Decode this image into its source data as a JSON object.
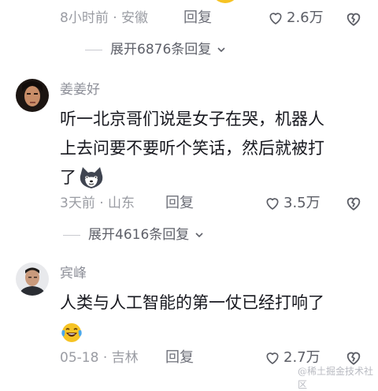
{
  "comments": [
    {
      "time": "8小时前",
      "location": "安徽",
      "reply": "回复",
      "likes": "2.6万",
      "expand": "展开6876条回复",
      "dot": "·"
    },
    {
      "username": "姜姜好",
      "text_line1": "听一北京哥们说是女子在哭，机器人",
      "text_line2": "上去问要不要听个笑话，然后就被打",
      "text_line3": "了",
      "emoji": "husky-dog-emoji",
      "time": "3天前",
      "location": "山东",
      "reply": "回复",
      "likes": "3.5万",
      "expand": "展开4616条回复",
      "dot": "·"
    },
    {
      "username": "宾峰",
      "text_line1": "人类与人工智能的第一仗已经打响了",
      "emoji": "laughing-tears-emoji",
      "time": "05-18",
      "location": "吉林",
      "reply": "回复",
      "likes": "2.7万",
      "dot": "·"
    }
  ],
  "watermark": "@稀土掘金技术社区",
  "colors": {
    "background": "#ffffff",
    "meta_gray": "#9a9ca3",
    "text": "#17181f",
    "emoji_yellow": "#f6c324"
  }
}
